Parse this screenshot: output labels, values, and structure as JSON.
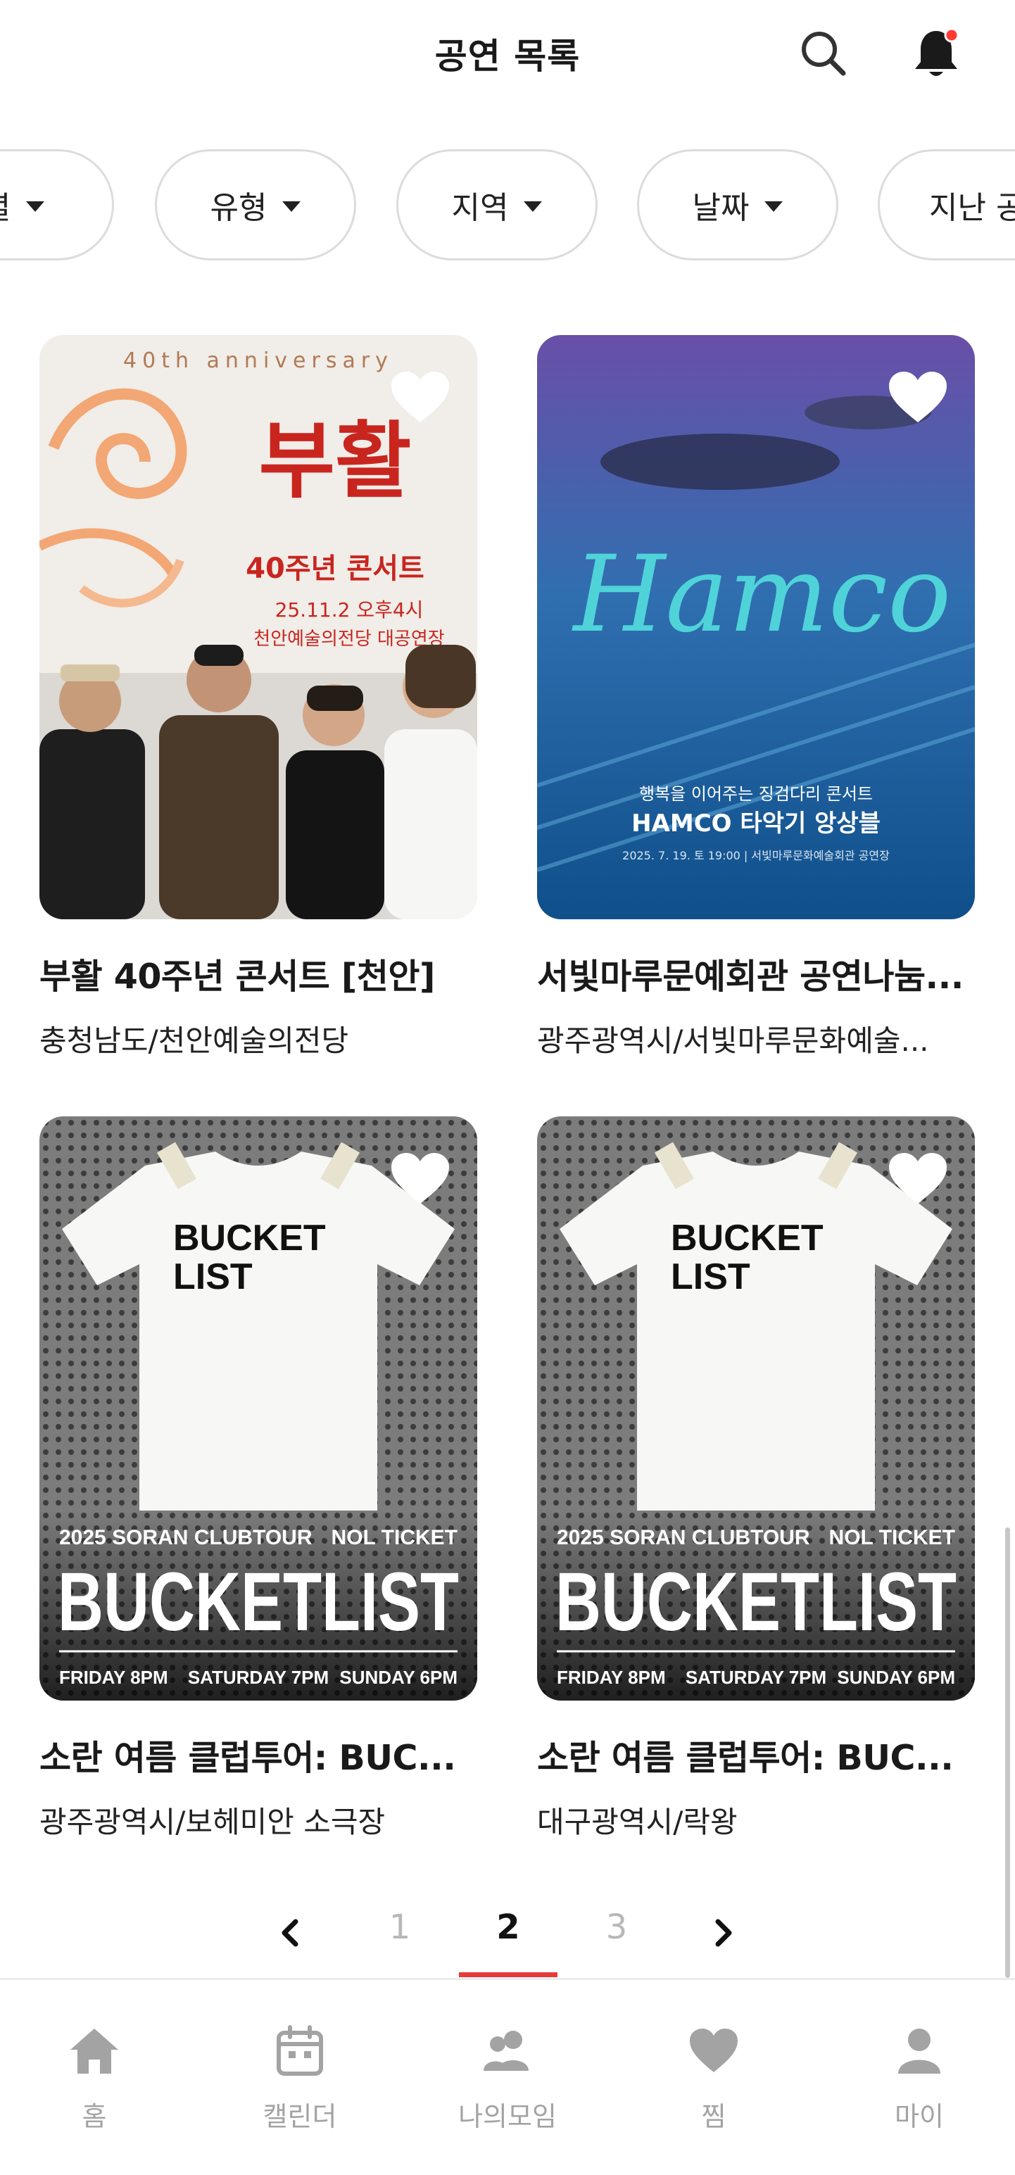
{
  "header": {
    "title": "공연 목록",
    "search_icon": "search-icon",
    "bell_icon": "bell-icon",
    "notification_dot_color": "#ff3b30"
  },
  "filters": [
    {
      "label": "렬"
    },
    {
      "label": "유형"
    },
    {
      "label": "지역"
    },
    {
      "label": "날짜"
    },
    {
      "label": "지난 공"
    }
  ],
  "cards": [
    {
      "title": "부활 40주년 콘서트 [천안]",
      "venue": "충청남도/천안예술의전당",
      "poster": {
        "top": "40th anniversary",
        "main": "부활",
        "sub": "40주년 콘서트",
        "line1": "25.11.2 오후4시",
        "line2": "천안예술의전당 대공연장"
      }
    },
    {
      "title": "서빛마루문예회관 공연나눔...",
      "venue": "광주광역시/서빛마루문화예술...",
      "poster": {
        "script": "Hamco",
        "sub": "행복을 이어주는 징검다리 콘서트",
        "main": "HAMCO 타악기 앙상블",
        "date": "2025. 7. 19. 토 19:00 | 서빛마루문화예술회관 공연장"
      }
    },
    {
      "title": "소란 여름 클럽투어: BUC...",
      "venue": "광주광역시/보헤미안 소극장",
      "poster": {
        "shirt1": "BUCKET",
        "shirt2": "LIST",
        "tour": "2025 SORAN CLUBTOUR",
        "ticket": "NOL TICKET",
        "main": "BUCKETLIST",
        "d1": "FRIDAY 8PM",
        "d2": "SATURDAY 7PM",
        "d3": "SUNDAY 6PM"
      }
    },
    {
      "title": "소란 여름 클럽투어: BUC...",
      "venue": "대구광역시/락왕",
      "poster": {
        "shirt1": "BUCKET",
        "shirt2": "LIST",
        "tour": "2025 SORAN CLUBTOUR",
        "ticket": "NOL TICKET",
        "main": "BUCKETLIST",
        "d1": "FRIDAY 8PM",
        "d2": "SATURDAY 7PM",
        "d3": "SUNDAY 6PM"
      }
    }
  ],
  "pagination": {
    "pages": [
      "1",
      "2",
      "3"
    ],
    "current": "2",
    "accent_color": "#e83a3a"
  },
  "bottom_nav": [
    {
      "label": "홈",
      "icon": "home-icon"
    },
    {
      "label": "캘린더",
      "icon": "calendar-icon"
    },
    {
      "label": "나의모임",
      "icon": "group-icon"
    },
    {
      "label": "찜",
      "icon": "heart-icon"
    },
    {
      "label": "마이",
      "icon": "profile-icon"
    }
  ]
}
